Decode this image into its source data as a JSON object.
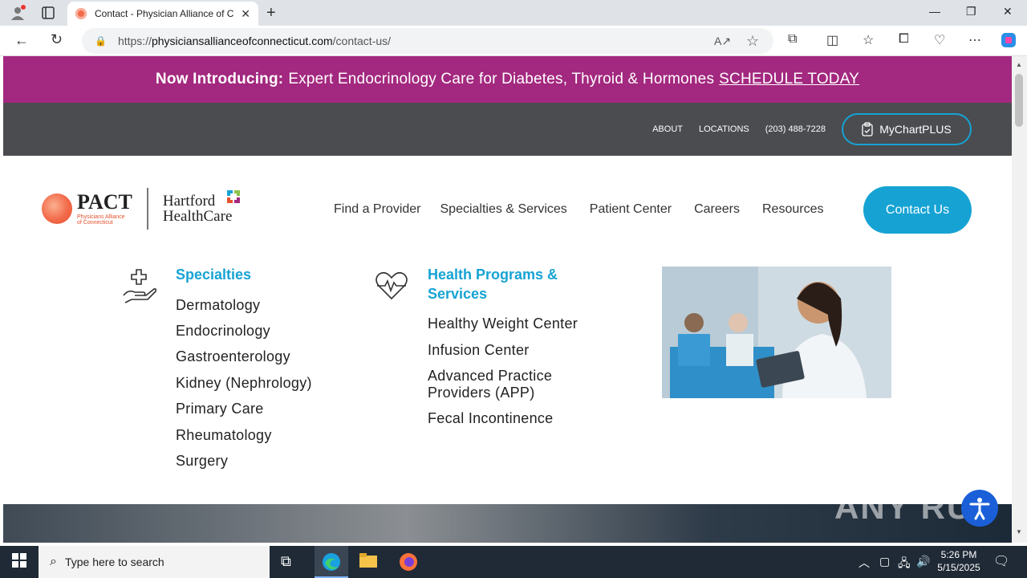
{
  "browser": {
    "tab_title": "Contact - Physician Alliance of C",
    "url_prefix": "https://",
    "url_host": "physiciansallianceofconnecticut.com",
    "url_path": "/contact-us/"
  },
  "promo": {
    "bold": "Now Introducing:",
    "text": "Expert Endocrinology Care for Diabetes, Thyroid & Hormones",
    "link": "SCHEDULE TODAY"
  },
  "utility": {
    "about": "ABOUT",
    "locations": "LOCATIONS",
    "phone": "(203) 488-7228",
    "mychart": "MyChartPLUS"
  },
  "logo": {
    "pact": "PACT",
    "pact_sub1": "Physicians Alliance",
    "pact_sub2": "of Connecticut",
    "hhc_line1": "Hartford",
    "hhc_line2": "HealthCare"
  },
  "nav": {
    "find": "Find a Provider",
    "specialties": "Specialties & Services",
    "patient": "Patient Center",
    "careers": "Careers",
    "resources": "Resources",
    "contact": "Contact Us"
  },
  "mega": {
    "specialties_title": "Specialties",
    "specialties": [
      "Dermatology",
      "Endocrinology",
      "Gastroenterology",
      "Kidney (Nephrology)",
      "Primary Care",
      "Rheumatology",
      "Surgery"
    ],
    "programs_title_1": "Health Programs &",
    "programs_title_2": "Services",
    "programs": [
      "Healthy Weight Center",
      "Infusion Center",
      "Advanced Practice",
      "Providers (APP)",
      "Fecal Incontinence"
    ]
  },
  "watermark": "ANY RUN",
  "taskbar": {
    "search_placeholder": "Type here to search",
    "time": "5:26 PM",
    "date": "5/15/2025"
  }
}
